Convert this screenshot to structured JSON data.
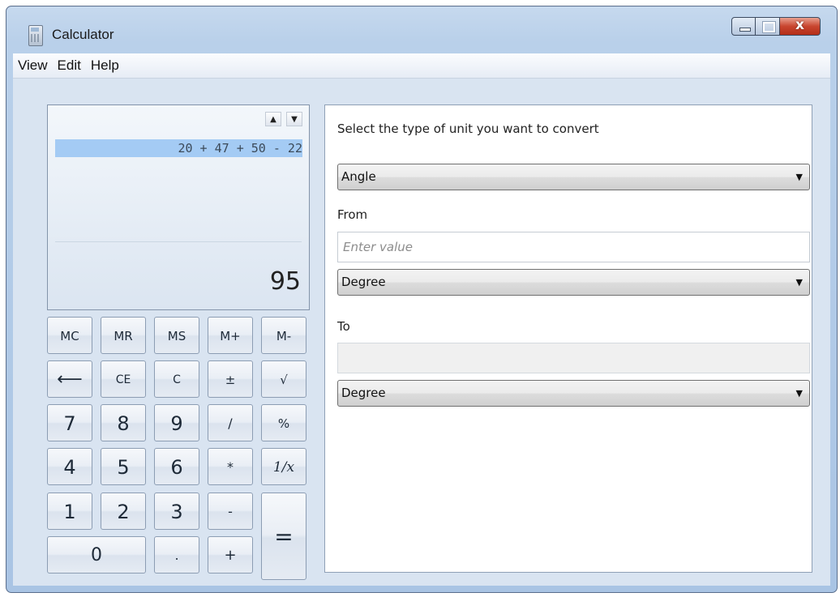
{
  "window": {
    "title": "Calculator",
    "app_icon": "calculator-icon",
    "close_glyph": "x"
  },
  "menu": [
    "View",
    "Edit",
    "Help"
  ],
  "display": {
    "scroll_up": "▲",
    "scroll_down": "▼",
    "history": "20 + 47 + 50 - 22",
    "result": "95"
  },
  "keypad": [
    {
      "label": "MC",
      "name": "mc-button"
    },
    {
      "label": "MR",
      "name": "mr-button"
    },
    {
      "label": "MS",
      "name": "ms-button"
    },
    {
      "label": "M+",
      "name": "m-plus-button"
    },
    {
      "label": "M-",
      "name": "m-minus-button"
    },
    {
      "label": "⟵",
      "name": "backspace-button"
    },
    {
      "label": "CE",
      "name": "ce-button"
    },
    {
      "label": "C",
      "name": "clear-button"
    },
    {
      "label": "±",
      "name": "plus-minus-button"
    },
    {
      "label": "√",
      "name": "sqrt-button"
    },
    {
      "label": "7",
      "name": "digit-7-button"
    },
    {
      "label": "8",
      "name": "digit-8-button"
    },
    {
      "label": "9",
      "name": "digit-9-button"
    },
    {
      "label": "/",
      "name": "divide-button"
    },
    {
      "label": "%",
      "name": "percent-button"
    },
    {
      "label": "4",
      "name": "digit-4-button"
    },
    {
      "label": "5",
      "name": "digit-5-button"
    },
    {
      "label": "6",
      "name": "digit-6-button"
    },
    {
      "label": "*",
      "name": "multiply-button"
    },
    {
      "label": "1/x",
      "name": "reciprocal-button"
    },
    {
      "label": "1",
      "name": "digit-1-button"
    },
    {
      "label": "2",
      "name": "digit-2-button"
    },
    {
      "label": "3",
      "name": "digit-3-button"
    },
    {
      "label": "-",
      "name": "subtract-button"
    },
    {
      "label": "=",
      "name": "equals-button"
    },
    {
      "label": "0",
      "name": "digit-0-button"
    },
    {
      "label": ".",
      "name": "decimal-button"
    },
    {
      "label": "+",
      "name": "add-button"
    }
  ],
  "converter": {
    "prompt": "Select the type of unit you want to convert",
    "unit_type": "Angle",
    "from_label": "From",
    "from_placeholder": "Enter value",
    "from_unit": "Degree",
    "to_label": "To",
    "to_value": "",
    "to_unit": "Degree",
    "dropdown_arrow": "▼"
  }
}
